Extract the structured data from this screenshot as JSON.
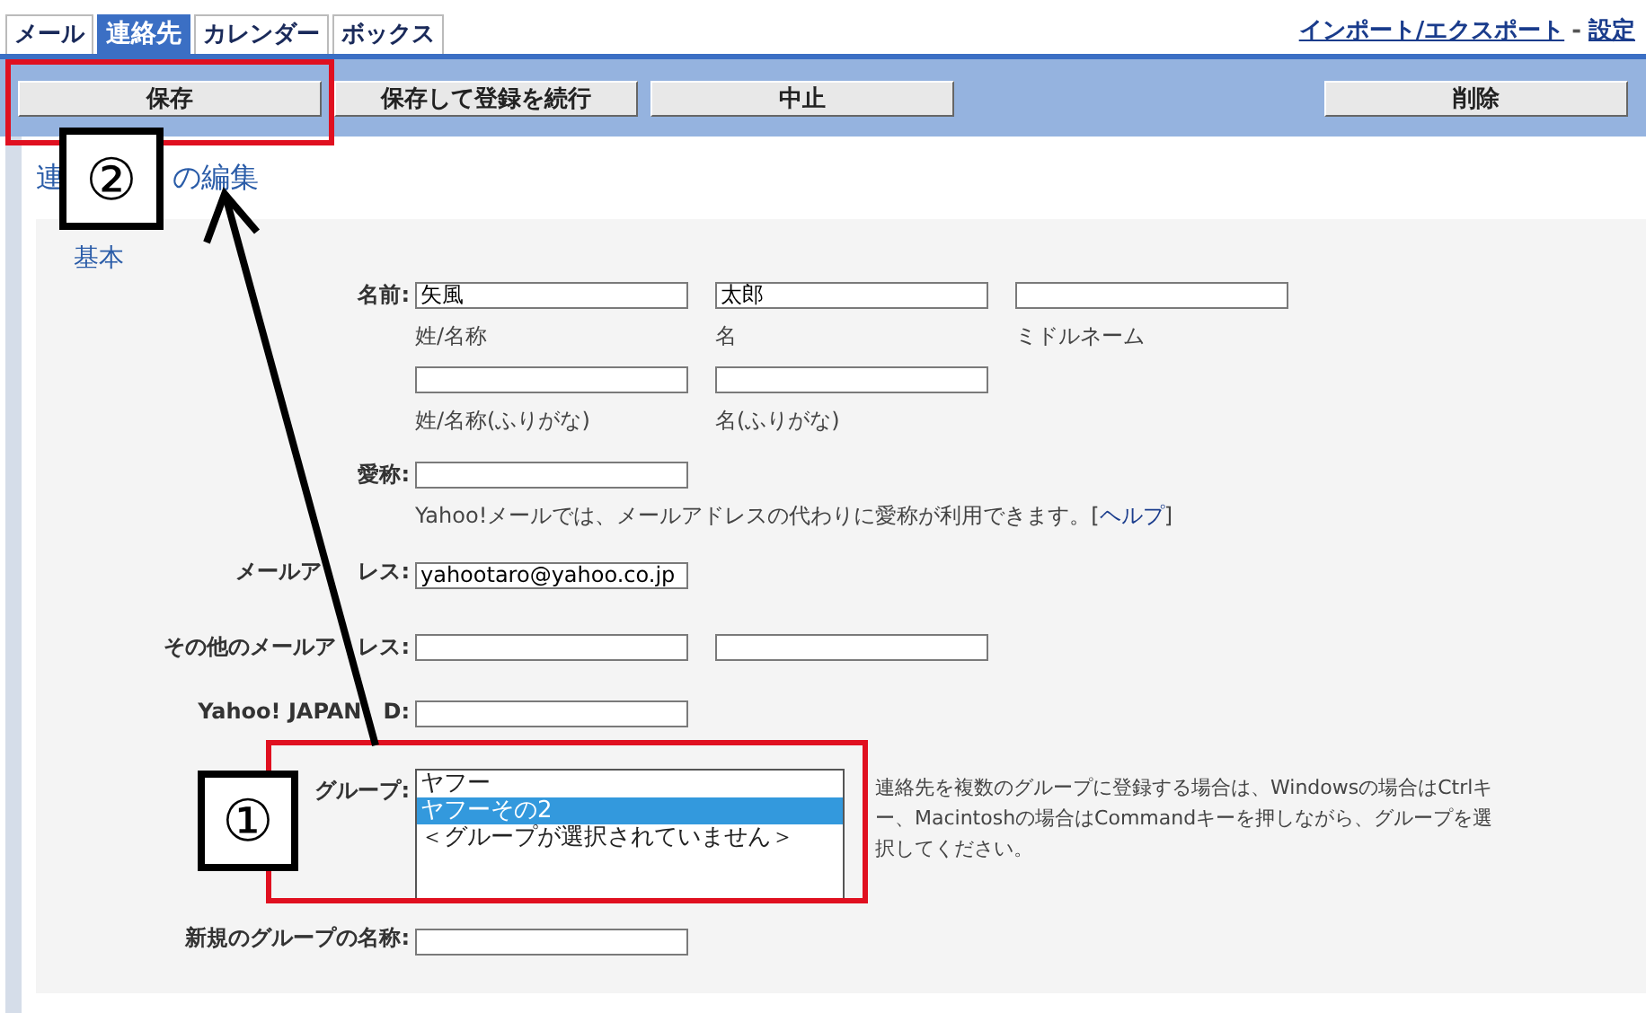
{
  "tabs": [
    {
      "label": "メール",
      "selected": false
    },
    {
      "label": "連絡先",
      "selected": true
    },
    {
      "label": "カレンダー",
      "selected": false
    },
    {
      "label": "ボックス",
      "selected": false
    }
  ],
  "top_links": {
    "import_export": "インポート/エクスポート",
    "separator": "-",
    "settings": "設定"
  },
  "toolbar": {
    "left_buttons": [
      "保存",
      "保存して登録を続行",
      "中止"
    ],
    "right_buttons": [
      "削除"
    ]
  },
  "heading": {
    "visible_start": "連",
    "visible_end": "の編集"
  },
  "section": "基本",
  "name_row": {
    "label": "名前:",
    "fields": [
      {
        "value": "矢風",
        "caption": "姓/名称"
      },
      {
        "value": "太郎",
        "caption": "名"
      },
      {
        "caption": "ミドルネーム"
      }
    ]
  },
  "kana_row": {
    "fields": [
      {
        "caption": "姓/名称(ふりがな)"
      },
      {
        "caption": "名(ふりがな)"
      }
    ]
  },
  "nickname": {
    "label": "愛称:",
    "hint": "Yahoo!メールでは、メールアドレスの代わりに愛称が利用できます。[",
    "help_link": "ヘルプ",
    "hint_end": "]"
  },
  "email": {
    "label_start": "メールア",
    "label_end": "レス:",
    "value": "yahootaro@yahoo.co.jp"
  },
  "other_email": {
    "label_start": "その他のメールア",
    "label_end": "レス:"
  },
  "yahoo_id": {
    "label_start": "Yahoo! JAPAN",
    "label_end": "D:"
  },
  "group": {
    "label": "グループ:",
    "options": [
      {
        "label": "ヤフー",
        "selected": false
      },
      {
        "label": "ヤフーその2",
        "selected": true
      },
      {
        "label": "＜グループが選択されていません＞",
        "selected": false
      }
    ],
    "note": "連絡先を複数のグループに登録する場合は、Windowsの場合はCtrlキー、Macintoshの場合はCommandキーを押しながら、グループを選択してください。"
  },
  "new_group": {
    "label": "新規のグループの名称:"
  },
  "annotations": [
    {
      "label": "②"
    },
    {
      "label": "①"
    }
  ]
}
